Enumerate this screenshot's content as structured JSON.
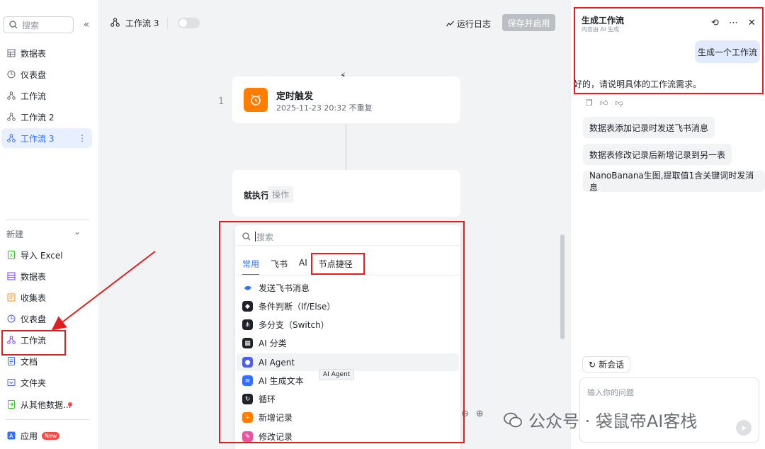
{
  "sidebar": {
    "search_placeholder": "搜索",
    "top_items": [
      {
        "label": "数据表",
        "icon": "table-icon"
      },
      {
        "label": "仪表盘",
        "icon": "dashboard-icon"
      },
      {
        "label": "工作流",
        "icon": "workflow-icon"
      },
      {
        "label": "工作流 2",
        "icon": "workflow-icon"
      },
      {
        "label": "工作流 3",
        "icon": "workflow-icon",
        "active": true
      }
    ],
    "new_label": "新建",
    "new_items": [
      {
        "label": "导入 Excel",
        "icon": "excel-icon"
      },
      {
        "label": "数据表",
        "icon": "table-icon"
      },
      {
        "label": "收集表",
        "icon": "form-icon"
      },
      {
        "label": "仪表盘",
        "icon": "dashboard-icon"
      },
      {
        "label": "工作流",
        "icon": "workflow-icon"
      },
      {
        "label": "文档",
        "icon": "doc-icon"
      },
      {
        "label": "文件夹",
        "icon": "folder-icon"
      },
      {
        "label": "从其他数据...",
        "icon": "import-icon"
      }
    ],
    "app_label": "应用",
    "new_badge": "New"
  },
  "canvas": {
    "title": "工作流 3",
    "run_log": "运行日志",
    "save_button": "保存并启用",
    "step_number": "1",
    "trigger": {
      "title": "定时触发",
      "subtitle": "2025-11-23 20:32 不重复"
    },
    "action": {
      "title": "就执行",
      "chip": "操作"
    },
    "dropdown": {
      "search_placeholder": "搜索",
      "tabs": [
        "常用",
        "飞书",
        "AI",
        "节点捷径"
      ],
      "items": [
        {
          "label": "发送飞书消息",
          "color": "#3370ff"
        },
        {
          "label": "条件判断（If/Else）",
          "color": "#1f2329"
        },
        {
          "label": "多分支（Switch）",
          "color": "#1f2329"
        },
        {
          "label": "AI 分类",
          "color": "#1f2329"
        },
        {
          "label": "AI Agent",
          "color": "#4e5ee8"
        },
        {
          "label": "AI 生成文本",
          "color": "#3370ff"
        },
        {
          "label": "循环",
          "color": "#1f2329"
        },
        {
          "label": "新增记录",
          "color": "#ff7d00"
        },
        {
          "label": "修改记录",
          "color": "#e8559e"
        }
      ],
      "tooltip": "AI Agent"
    }
  },
  "right_panel": {
    "title": "生成工作流",
    "subtitle": "内容由 AI 生成",
    "user_message": "生成一个工作流",
    "bot_message": "好的，请说明具体的工作流需求。",
    "suggestions": [
      "数据表添加记录时发送飞书消息",
      "数据表修改记录后新增记录到另一表",
      "NanoBanana生图,提取值1含关键词时发消息"
    ],
    "new_chat": "新会话",
    "input_placeholder": "输入你的问题"
  },
  "watermark": "公众号 · 袋鼠帝AI客栈",
  "colors": {
    "accent": "#3370ff",
    "annotation": "#e02020",
    "trigger": "#ff7d00"
  }
}
